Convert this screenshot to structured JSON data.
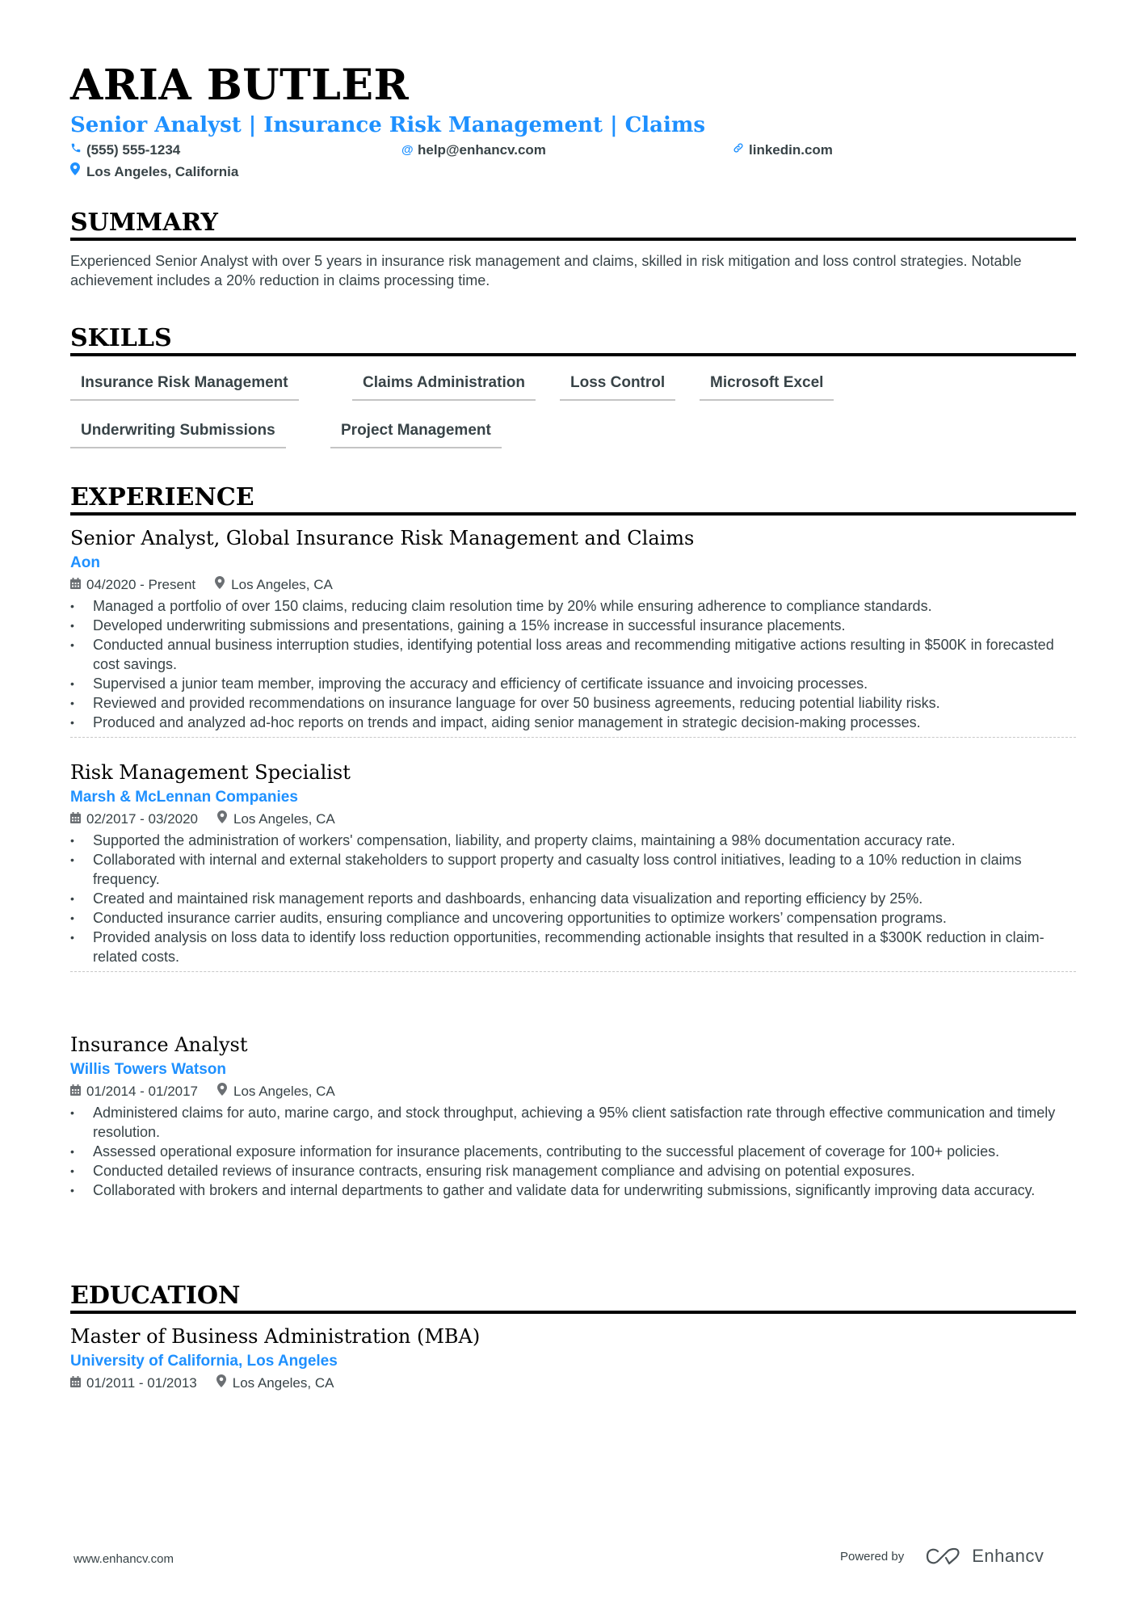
{
  "header": {
    "name": "ARIA BUTLER",
    "title": "Senior Analyst | Insurance Risk Management | Claims",
    "phone": "(555) 555-1234",
    "email": "help@enhancv.com",
    "link": "linkedin.com",
    "location": "Los Angeles, California",
    "icons": {
      "phone": "phone-icon",
      "email": "at-icon",
      "link": "link-icon",
      "location": "map-pin-icon"
    }
  },
  "summary": {
    "heading": "SUMMARY",
    "text": "Experienced Senior Analyst with over 5 years in insurance risk management and claims, skilled in risk mitigation and loss control strategies. Notable achievement includes a 20% reduction in claims processing time."
  },
  "skills": {
    "heading": "SKILLS",
    "items": [
      "Insurance Risk Management",
      "Claims Administration",
      "Loss Control",
      "Microsoft Excel",
      "Underwriting Submissions",
      "Project Management"
    ]
  },
  "experience": {
    "heading": "EXPERIENCE",
    "jobs": [
      {
        "title": "Senior Analyst, Global Insurance Risk Management and Claims",
        "company": "Aon",
        "dates": "04/2020 - Present",
        "location": "Los Angeles, CA",
        "bullets": [
          "Managed a portfolio of over 150 claims, reducing claim resolution time by 20% while ensuring adherence to compliance standards.",
          "Developed underwriting submissions and presentations, gaining a 15% increase in successful insurance placements.",
          "Conducted annual business interruption studies, identifying potential loss areas and recommending mitigative actions resulting in $500K in forecasted cost savings.",
          "Supervised a junior team member, improving the accuracy and efficiency of certificate issuance and invoicing processes.",
          "Reviewed and provided recommendations on insurance language for over 50 business agreements, reducing potential liability risks.",
          "Produced and analyzed ad-hoc reports on trends and impact, aiding senior management in strategic decision-making processes."
        ]
      },
      {
        "title": "Risk Management Specialist",
        "company": "Marsh & McLennan Companies",
        "dates": "02/2017 - 03/2020",
        "location": "Los Angeles, CA",
        "bullets": [
          "Supported the administration of workers' compensation, liability, and property claims, maintaining a 98% documentation accuracy rate.",
          "Collaborated with internal and external stakeholders to support property and casualty loss control initiatives, leading to a 10% reduction in claims frequency.",
          "Created and maintained risk management reports and dashboards, enhancing data visualization and reporting efficiency by 25%.",
          "Conducted insurance carrier audits, ensuring compliance and uncovering opportunities to optimize workers’ compensation programs.",
          "Provided analysis on loss data to identify loss reduction opportunities, recommending actionable insights that resulted in a $300K reduction in claim-related costs."
        ]
      },
      {
        "title": "Insurance Analyst",
        "company": "Willis Towers Watson",
        "dates": "01/2014 - 01/2017",
        "location": "Los Angeles, CA",
        "bullets": [
          "Administered claims for auto, marine cargo, and stock throughput, achieving a 95% client satisfaction rate through effective communication and timely resolution.",
          "Assessed operational exposure information for insurance placements, contributing to the successful placement of coverage for 100+ policies.",
          "Conducted detailed reviews of insurance contracts, ensuring risk management compliance and advising on potential exposures.",
          "Collaborated with brokers and internal departments to gather and validate data for underwriting submissions, significantly improving data accuracy."
        ]
      }
    ]
  },
  "education": {
    "heading": "EDUCATION",
    "items": [
      {
        "degree": "Master of Business Administration (MBA)",
        "school": "University of California, Los Angeles",
        "dates": "01/2011 - 01/2013",
        "location": "Los Angeles, CA"
      }
    ]
  },
  "footer": {
    "website": "www.enhancv.com",
    "powered_by": "Powered by",
    "brand": "Enhancv"
  },
  "colors": {
    "accent": "#1e90ff",
    "text": "#384347",
    "heading": "#000000"
  }
}
